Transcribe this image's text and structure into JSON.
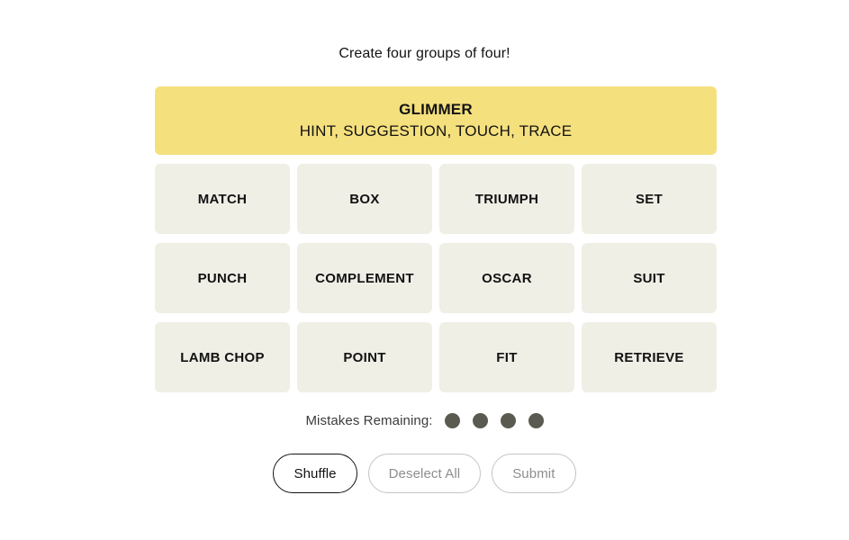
{
  "puzzle": {
    "title": "Create four groups of four!"
  },
  "solved_groups": [
    {
      "category": "GLIMMER",
      "members_text": "HINT, SUGGESTION, TOUCH, TRACE",
      "color": "#f5e07e"
    }
  ],
  "tiles": [
    {
      "label": "MATCH"
    },
    {
      "label": "BOX"
    },
    {
      "label": "TRIUMPH"
    },
    {
      "label": "SET"
    },
    {
      "label": "PUNCH"
    },
    {
      "label": "COMPLEMENT"
    },
    {
      "label": "OSCAR"
    },
    {
      "label": "SUIT"
    },
    {
      "label": "LAMB CHOP"
    },
    {
      "label": "POINT"
    },
    {
      "label": "FIT"
    },
    {
      "label": "RETRIEVE"
    }
  ],
  "mistakes": {
    "label": "Mistakes Remaining:",
    "remaining": 4,
    "dot_color": "#5a5a50"
  },
  "controls": {
    "shuffle_label": "Shuffle",
    "deselect_label": "Deselect All",
    "submit_label": "Submit"
  },
  "colors": {
    "page_background": "#ffffff",
    "tile_background": "#efefe6",
    "tile_text": "#121212",
    "yellow_category": "#f5e07e",
    "disabled_text": "#8e8e8e",
    "disabled_border": "#c4c4c4"
  }
}
